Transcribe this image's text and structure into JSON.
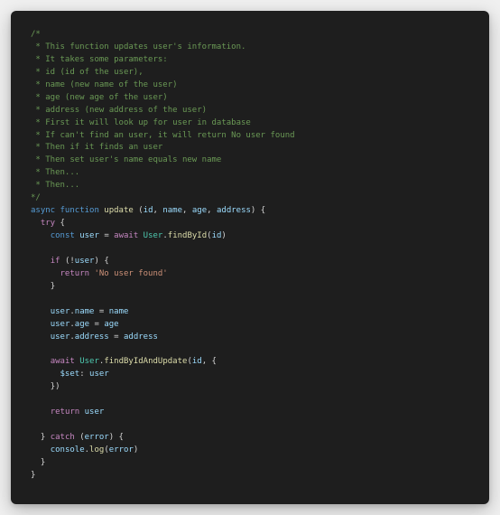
{
  "code": {
    "comments": {
      "open": "/*",
      "l1": " * This function updates user's information.",
      "l2": " * It takes some parameters:",
      "l3": " * id (id of the user),",
      "l4": " * name (new name of the user)",
      "l5": " * age (new age of the user)",
      "l6": " * address (new address of the user)",
      "l7": " * First it will look up for user in database",
      "l8": " * If can't find an user, it will return No user found",
      "l9": " * Then if it finds an user",
      "l10": " * Then set user's name equals new name",
      "l11": " * Then...",
      "l12": " * Then...",
      "close": "*/"
    },
    "kw": {
      "async": "async",
      "function": "function",
      "try": "try",
      "const": "const",
      "await": "await",
      "if": "if",
      "return": "return",
      "catch": "catch"
    },
    "fn": {
      "update": "update",
      "findById": "findById",
      "findByIdAndUpdate": "findByIdAndUpdate",
      "log": "log"
    },
    "cls": {
      "User": "User"
    },
    "obj": {
      "console": "console"
    },
    "vars": {
      "id": "id",
      "name": "name",
      "age": "age",
      "address": "address",
      "user": "user",
      "error": "error",
      "set": "$set"
    },
    "str": {
      "noUser": "'No user found'"
    }
  }
}
